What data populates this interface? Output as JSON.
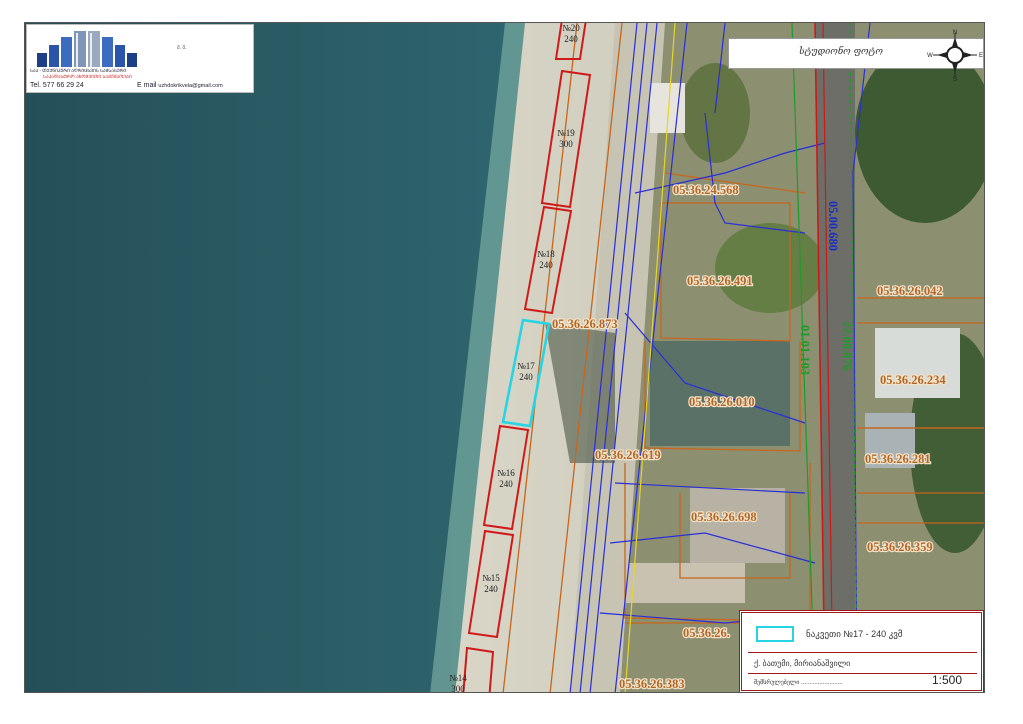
{
  "header": {
    "logo_mark": "შ. შ.",
    "company_line1": "ᲡᲐᲐ - ᲗᲔᲥᲜᲘᲙᲣᲠᲘ ᲐᲦᲠᲘᲪᲮᲕᲘᲡ ᲡᲐᲛᲡᲐᲮᲣᲠᲘ",
    "company_line2": "ᲡᲐᲙᲐᲓᲐᲡᲢᲠᲝ ᲐᲖᲝᲛᲕᲘᲗᲘ ᲡᲐᲛᲣᲨᲐᲝᲔᲑᲘ",
    "tel_label": "Tel.",
    "tel_value": "577 66 29 24",
    "email_label": "E mail",
    "email_value": "uzhdokrikvela@gmail.com"
  },
  "north": {
    "signature": "სტუდიონო ფოტო",
    "n": "N",
    "s": "S",
    "e": "E",
    "w": "W"
  },
  "plots": [
    {
      "id": "№20",
      "area": "240",
      "highlight": false
    },
    {
      "id": "№19",
      "area": "300",
      "highlight": false
    },
    {
      "id": "№18",
      "area": "240",
      "highlight": false
    },
    {
      "id": "№17",
      "area": "240",
      "highlight": true
    },
    {
      "id": "№16",
      "area": "240",
      "highlight": false
    },
    {
      "id": "№15",
      "area": "240",
      "highlight": false
    },
    {
      "id": "№14",
      "area": "300",
      "highlight": false
    }
  ],
  "cadastral_codes": [
    "05.36.24.568",
    "05.36.26.491",
    "05.36.26.042",
    "05.36.26.873",
    "05.36.26.234",
    "05.36.26.010",
    "05.36.26.281",
    "05.36.26.619",
    "05.36.26.698",
    "05.36.26.359",
    "05.36.26.383"
  ],
  "road_codes": [
    {
      "code": "05.00.680",
      "color": "#1a2fc0"
    },
    {
      "code": "01.01.103",
      "color": "#1f9b2a"
    },
    {
      "code": "22.00.076",
      "color": "#1f9b2a"
    }
  ],
  "partial_code": "05.36.26.",
  "legend": {
    "swatch_color": "#26d4e4",
    "label": "ნაკვეთი №17 - 240 კვმ",
    "city": "ქ. ბათუმი, მირიანაშვილი",
    "author": "შემსრულებელი .........................",
    "scale": "1:500"
  },
  "colors": {
    "plot_outline": "#d01a1a",
    "selected_plot": "#26d4e4",
    "cadastral_line": "#c7661c",
    "utility_line": "#2a2ed8",
    "road_line": "#cc1a1a",
    "green_line": "#1f9b2a"
  }
}
